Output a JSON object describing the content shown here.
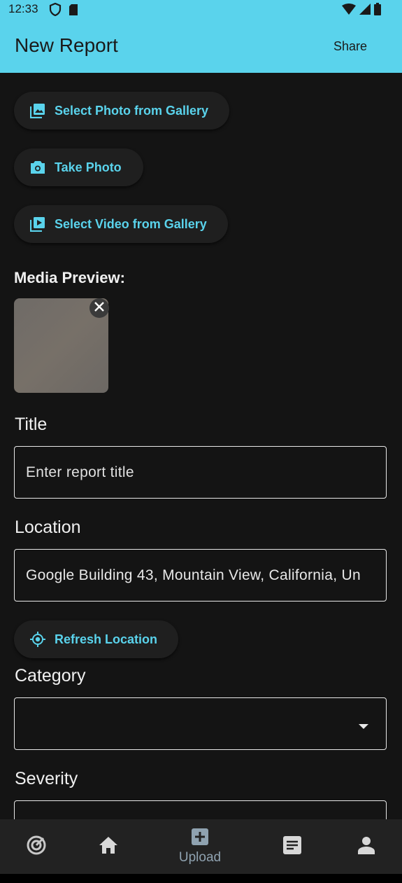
{
  "status_bar": {
    "time": "12:33"
  },
  "app_bar": {
    "title": "New Report",
    "share_label": "Share"
  },
  "actions": {
    "select_photo": "Select Photo from Gallery",
    "take_photo": "Take Photo",
    "select_video": "Select Video from Gallery"
  },
  "media_preview": {
    "heading": "Media Preview:"
  },
  "form": {
    "title_label": "Title",
    "title_placeholder": "Enter report title",
    "location_label": "Location",
    "location_value": "Google Building 43, Mountain View, California, Un",
    "refresh_location": "Refresh Location",
    "category_label": "Category",
    "category_value": "",
    "severity_label": "Severity"
  },
  "bottom_nav": {
    "items": [
      {
        "icon": "radar-icon",
        "label": ""
      },
      {
        "icon": "home-icon",
        "label": ""
      },
      {
        "icon": "add-box-icon",
        "label": "Upload"
      },
      {
        "icon": "article-icon",
        "label": ""
      },
      {
        "icon": "person-icon",
        "label": ""
      }
    ]
  },
  "colors": {
    "accent": "#5ad3ec",
    "background": "#141414",
    "nav_label": "#8fa2b0"
  }
}
